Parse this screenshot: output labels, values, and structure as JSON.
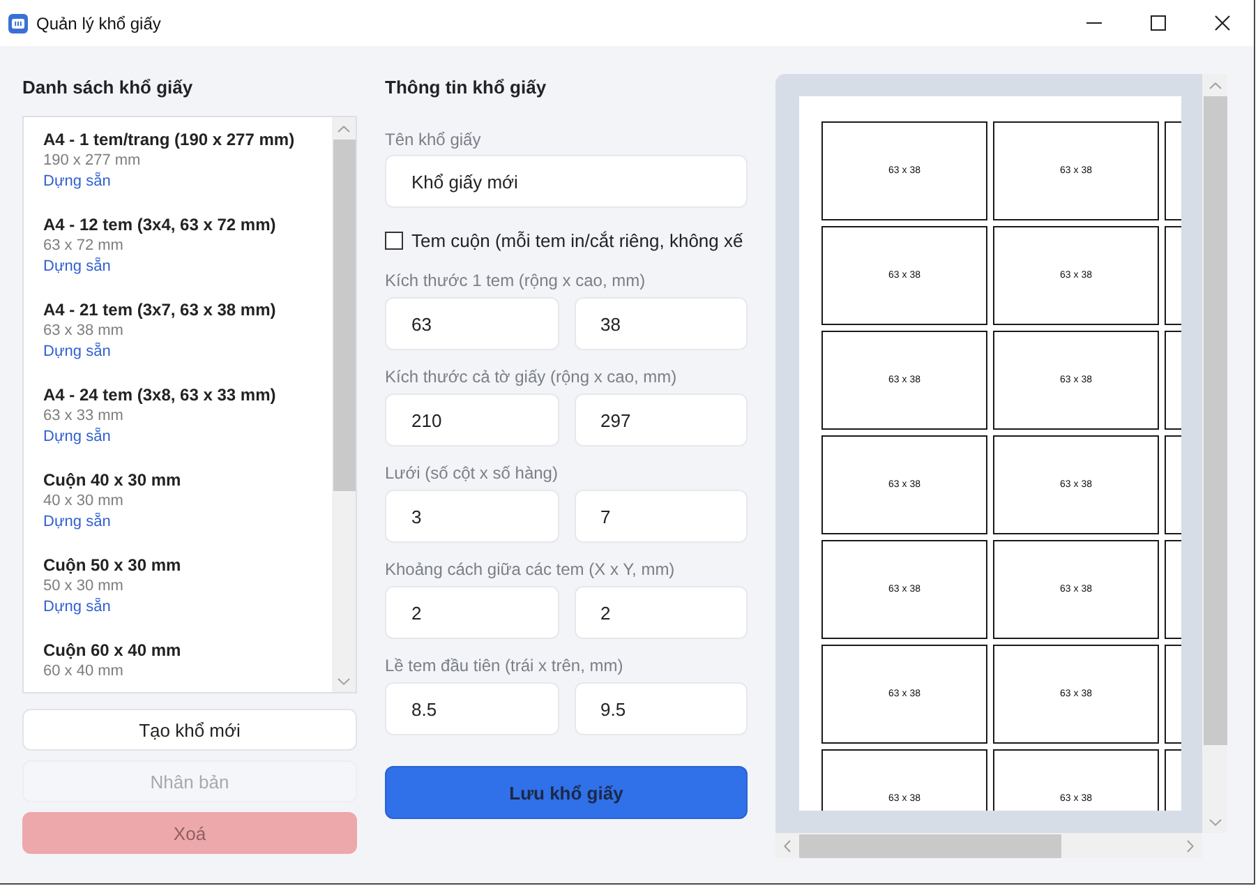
{
  "window": {
    "title": "Quản lý khổ giấy"
  },
  "list_panel": {
    "heading": "Danh sách khổ giấy",
    "items": [
      {
        "title": "A4 - 1 tem/trang (190 x 277 mm)",
        "size": "190 x 277 mm",
        "tag": "Dựng sẵn",
        "selected": false
      },
      {
        "title": "A4 - 12 tem (3x4, 63 x 72 mm)",
        "size": "63 x 72 mm",
        "tag": "Dựng sẵn",
        "selected": false
      },
      {
        "title": "A4 - 21 tem (3x7, 63 x 38 mm)",
        "size": "63 x 38 mm",
        "tag": "Dựng sẵn",
        "selected": false
      },
      {
        "title": "A4 - 24 tem (3x8, 63 x 33 mm)",
        "size": "63 x 33 mm",
        "tag": "Dựng sẵn",
        "selected": false
      },
      {
        "title": "Cuộn 40 x 30 mm",
        "size": "40 x 30 mm",
        "tag": "Dựng sẵn",
        "selected": false
      },
      {
        "title": "Cuộn 50 x 30 mm",
        "size": "50 x 30 mm",
        "tag": "Dựng sẵn",
        "selected": false
      },
      {
        "title": "Cuộn 60 x 40 mm",
        "size": "60 x 40 mm",
        "selected": false
      }
    ]
  },
  "list_buttons": [
    {
      "label": "Tạo khổ mới",
      "kind": "default",
      "disabled": false
    },
    {
      "label": "Nhân bản",
      "kind": "default",
      "disabled": true
    },
    {
      "label": "Xoá",
      "kind": "danger",
      "disabled": true
    }
  ],
  "form": {
    "heading": "Thông tin khổ giấy",
    "name_field": {
      "label": "Tên khổ giấy",
      "value": "Khổ giấy mới"
    },
    "roll_checkbox": {
      "label": "Tem cuộn (mỗi tem in/cắt riêng, không xế",
      "checked": false
    },
    "pairs": [
      {
        "label": "Kích thước 1 tem (rộng x cao, mm)",
        "values": [
          "63",
          "38"
        ]
      },
      {
        "label": "Kích thước cả tờ giấy (rộng x cao, mm)",
        "values": [
          "210",
          "297"
        ]
      },
      {
        "label": "Lưới (số cột x số hàng)",
        "values": [
          "3",
          "7"
        ]
      },
      {
        "label": "Khoảng cách giữa các tem (X x Y, mm)",
        "values": [
          "2",
          "2"
        ]
      },
      {
        "label": "Lề tem đầu tiên (trái x trên, mm)",
        "values": [
          "8.5",
          "9.5"
        ]
      }
    ],
    "save_button": {
      "label": "Lưu khổ giấy"
    }
  },
  "preview": {
    "rows": [
      {
        "cells": [
          {
            "text": "63 x 38"
          },
          {
            "text": "63 x 38"
          },
          {}
        ]
      },
      {
        "cells": [
          {
            "text": "63 x 38"
          },
          {
            "text": "63 x 38"
          },
          {}
        ]
      },
      {
        "cells": [
          {
            "text": "63 x 38"
          },
          {
            "text": "63 x 38"
          },
          {}
        ]
      },
      {
        "cells": [
          {
            "text": "63 x 38"
          },
          {
            "text": "63 x 38"
          },
          {}
        ]
      },
      {
        "cells": [
          {
            "text": "63 x 38"
          },
          {
            "text": "63 x 38"
          },
          {}
        ]
      },
      {
        "cells": [
          {
            "text": "63 x 38"
          },
          {
            "text": "63 x 38"
          },
          {}
        ]
      },
      {
        "cells": [
          {
            "text": "63 x 38"
          },
          {
            "text": "63 x 38"
          },
          {}
        ]
      }
    ]
  }
}
